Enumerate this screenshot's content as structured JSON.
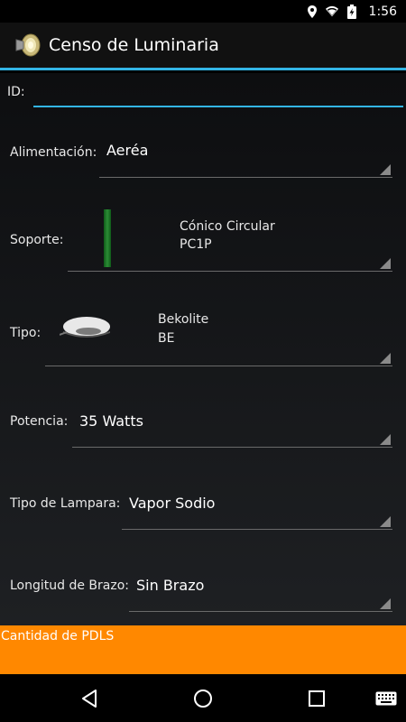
{
  "status_bar": {
    "time": "1:56",
    "icons": [
      "location-icon",
      "wifi-icon",
      "battery-charging-icon"
    ]
  },
  "app_bar": {
    "title": "Censo de Luminaria",
    "icon": "lamp-speaker-icon"
  },
  "form": {
    "id": {
      "label": "ID:",
      "value": "",
      "placeholder": ""
    },
    "alimentacion": {
      "label": "Alimentación:",
      "value": "Aeréa"
    },
    "soporte": {
      "label": "Soporte:",
      "value_line1": "Cónico Circular",
      "value_line2": "PC1P",
      "image": "green-pole-image"
    },
    "tipo": {
      "label": "Tipo:",
      "value_line1": "Bekolite",
      "value_line2": "BE",
      "image": "street-lamp-image"
    },
    "potencia": {
      "label": "Potencia:",
      "value": "35 Watts"
    },
    "tipo_lampara": {
      "label": "Tipo de Lampara:",
      "value": "Vapor Sodio"
    },
    "longitud_brazo": {
      "label": "Longitud de Brazo:",
      "value": "Sin Brazo"
    }
  },
  "footer": {
    "label": "Cantidad de PDLS",
    "color": "#ff8800"
  },
  "nav_bar": {
    "buttons": [
      "back-icon",
      "home-icon",
      "recents-icon",
      "keyboard-icon"
    ]
  },
  "colors": {
    "accent": "#33b5e5",
    "background": "#000000"
  }
}
